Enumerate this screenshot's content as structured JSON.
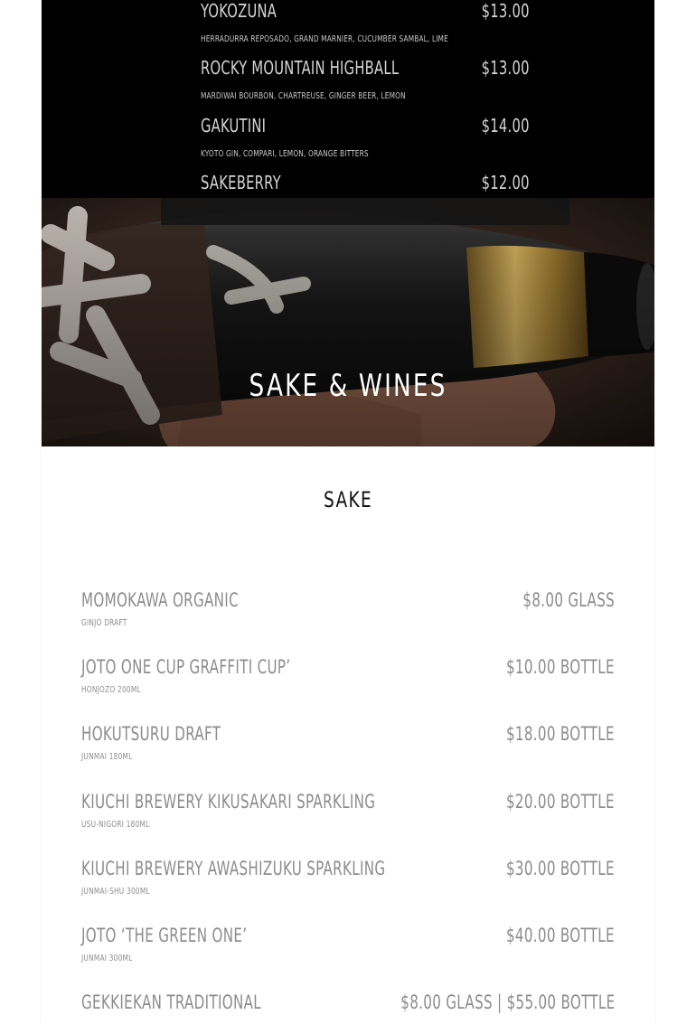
{
  "cocktails": [
    {
      "name": "Yokozuna",
      "price": "$13.00",
      "desc": "Herradurra reposado, Grand Marnier, cucumber sambal, lime"
    },
    {
      "name": "Rocky Mountain Highball",
      "price": "$13.00",
      "desc": "Mardiwai bourbon, Chartreuse, ginger beer, lemon"
    },
    {
      "name": "Gakutini",
      "price": "$14.00",
      "desc": "Kyoto gin, Compari, lemon, orange bitters"
    },
    {
      "name": "Sakeberry",
      "price": "$12.00",
      "desc": ""
    }
  ],
  "hero": {
    "title": "Sake & Wines"
  },
  "sake_section": {
    "title": "Sake",
    "items": [
      {
        "name": "Momokawa Organic",
        "price": "$8.00 Glass",
        "desc": "Ginjo Draft"
      },
      {
        "name": "Joto One Cup Graffiti Cup’",
        "price": "$10.00 Bottle",
        "desc": "Honjozo 200ml"
      },
      {
        "name": "Hokutsuru Draft",
        "price": "$18.00 Bottle",
        "desc": "Junmai 180ml"
      },
      {
        "name": "Kiuchi Brewery Kikusakari Sparkling",
        "price": "$20.00 Bottle",
        "desc": "Usu-Nigori 180ml"
      },
      {
        "name": "Kiuchi Brewery Awashizuku Sparkling",
        "price": "$30.00 Bottle",
        "desc": "Junmai-Shu 300ml"
      },
      {
        "name": "Joto ‘The Green One’",
        "price": "$40.00 Bottle",
        "desc": "Junmai 300ml"
      },
      {
        "name": "Gekkiekan Traditional",
        "price": "$8.00 Glass | $55.00 Bottle",
        "desc": ""
      }
    ]
  },
  "colors": {
    "dark_bg": "#000000",
    "text_light": "#d4d4d4",
    "text_muted": "#8c8c8c",
    "title_dark": "#111111"
  }
}
